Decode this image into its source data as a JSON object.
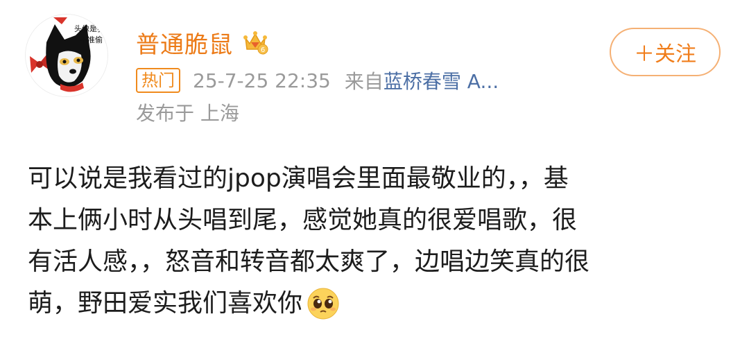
{
  "author": {
    "name": "普通脆鼠",
    "avatar_icon": "cartoon-dog-avatar-icon",
    "avatar_text": "头像是我 不准偷",
    "badge_icon": "crown-level-icon",
    "badge_level": "6"
  },
  "meta": {
    "hot_badge": "热门",
    "timestamp": "25-7-25 22:35",
    "source_prefix": "来自",
    "source_name": "蓝桥春雪 A...",
    "location": "发布于 上海"
  },
  "actions": {
    "follow_label": "＋关注"
  },
  "post": {
    "lines": [
      "可以说是我看过的jpop演唱会里面最敬业的，，基",
      "本上俩小时从头唱到尾，感觉她真的很爱唱歌，很",
      "有活人感，，怒音和转音都太爽了，边唱边笑真的很",
      "萌，野田爱实我们喜欢你"
    ],
    "trailing_emoji": "pleading-face-emoji"
  },
  "colors": {
    "username": "#ec7b18",
    "accent_orange": "#f08a1c",
    "follow_border": "#f5b074",
    "meta_gray": "#9a9a9a",
    "source_blue": "#4c6fa5",
    "text": "#1c1c1c"
  }
}
